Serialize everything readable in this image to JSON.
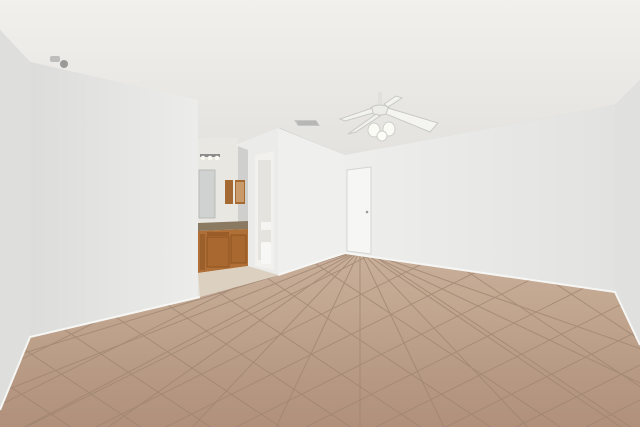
{
  "scene": {
    "colors": {
      "ceiling": "#e9e8e4",
      "wall_left": "#e8e8e6",
      "wall_back": "#eeeeec",
      "wall_right": "#e4e4e2",
      "floor_tile": "#b89a82",
      "grout": "#9e8470",
      "cabinet": "#b06f36",
      "counter": "#8a7a62",
      "door": "#f3f3f1",
      "shadow": "#c9c9c6"
    },
    "icons": [
      "ceiling-fan-icon",
      "ceiling-vent-icon",
      "wall-light-fixture-icon",
      "sensor-icon"
    ]
  }
}
